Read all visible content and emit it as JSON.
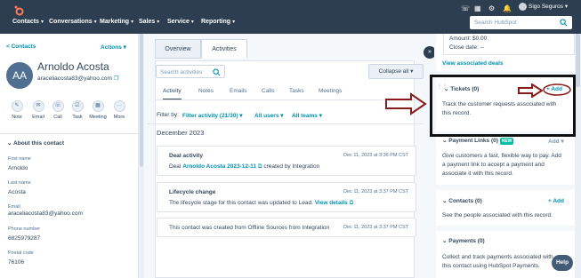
{
  "topnav": {
    "items": [
      "Contacts",
      "Conversations",
      "Marketing",
      "Sales",
      "Service",
      "Reporting"
    ],
    "search_placeholder": "Search HubSpot",
    "user": "Sigo Seguros"
  },
  "contact": {
    "back_link": "< Contacts",
    "actions": "Actions",
    "initials": "AA",
    "name": "Arnoldo Acosta",
    "email": "araceliacosta83@yahoo.com",
    "quick_actions": [
      "Note",
      "Email",
      "Call",
      "Task",
      "Meeting",
      "More"
    ],
    "about_title": "About this contact",
    "props": [
      {
        "label": "First name",
        "value": "Arnoldo"
      },
      {
        "label": "Last name",
        "value": "Acosta"
      },
      {
        "label": "Email",
        "value": "araceliacosta83@yahoo.com"
      },
      {
        "label": "Phone number",
        "value": "6825979287"
      },
      {
        "label": "Postal code",
        "value": "76106"
      }
    ]
  },
  "activity": {
    "tabs": [
      "Overview",
      "Activities"
    ],
    "search_placeholder": "Search activities",
    "collapse": "Collapse all",
    "subtabs": [
      "Activity",
      "Notes",
      "Emails",
      "Calls",
      "Tasks",
      "Meetings"
    ],
    "filter_by": "Filter by:",
    "filter_activity": "Filter activity (21/30)",
    "all_users": "All users",
    "all_teams": "All teams",
    "month": "December 2023",
    "cards": [
      {
        "title": "Deal activity",
        "date": "Dec 11, 2023 at 3:36 PM CST",
        "prefix": "Deal",
        "link": "Arnoldo Acosta 2023-12-11",
        "suffix": "created by Integration"
      },
      {
        "title": "Lifecycle change",
        "date": "Dec 11, 2023 at 3:37 PM CST",
        "text": "The lifecycle stage for this contact was updated to Lead.",
        "link": "View details"
      },
      {
        "date": "Dec 11, 2023 at 3:37 PM CST",
        "text": "This contact was created from Offline Sources from Integration"
      }
    ]
  },
  "sidebar": {
    "amount": "Amount: $0.00",
    "close_date": "Close date: --",
    "view_deals": "View associated deals",
    "tickets": {
      "title": "Tickets (0)",
      "add": "+ Add",
      "text1": "Track the customer requests associated with",
      "text2": "this record."
    },
    "payment_links": {
      "title": "Payment Links (0)",
      "badge": "NEW",
      "add": "Add",
      "text1": "Give customers a fast, flexible way to pay. Add",
      "text2": "a payment link to accept a payment and",
      "text3": "associate it with this record."
    },
    "contacts": {
      "title": "Contacts (0)",
      "add": "+ Add",
      "text": "See the people associated with this record."
    },
    "payments": {
      "title": "Payments (0)",
      "text1": "Collect and track payments associated with",
      "text2": "this contact using HubSpot Payments."
    },
    "help": "Help"
  },
  "colors": {
    "nav": "#2d3e50",
    "link": "#0091ae",
    "annotation_red": "#8b1a1a",
    "new_badge": "#00bda5"
  }
}
